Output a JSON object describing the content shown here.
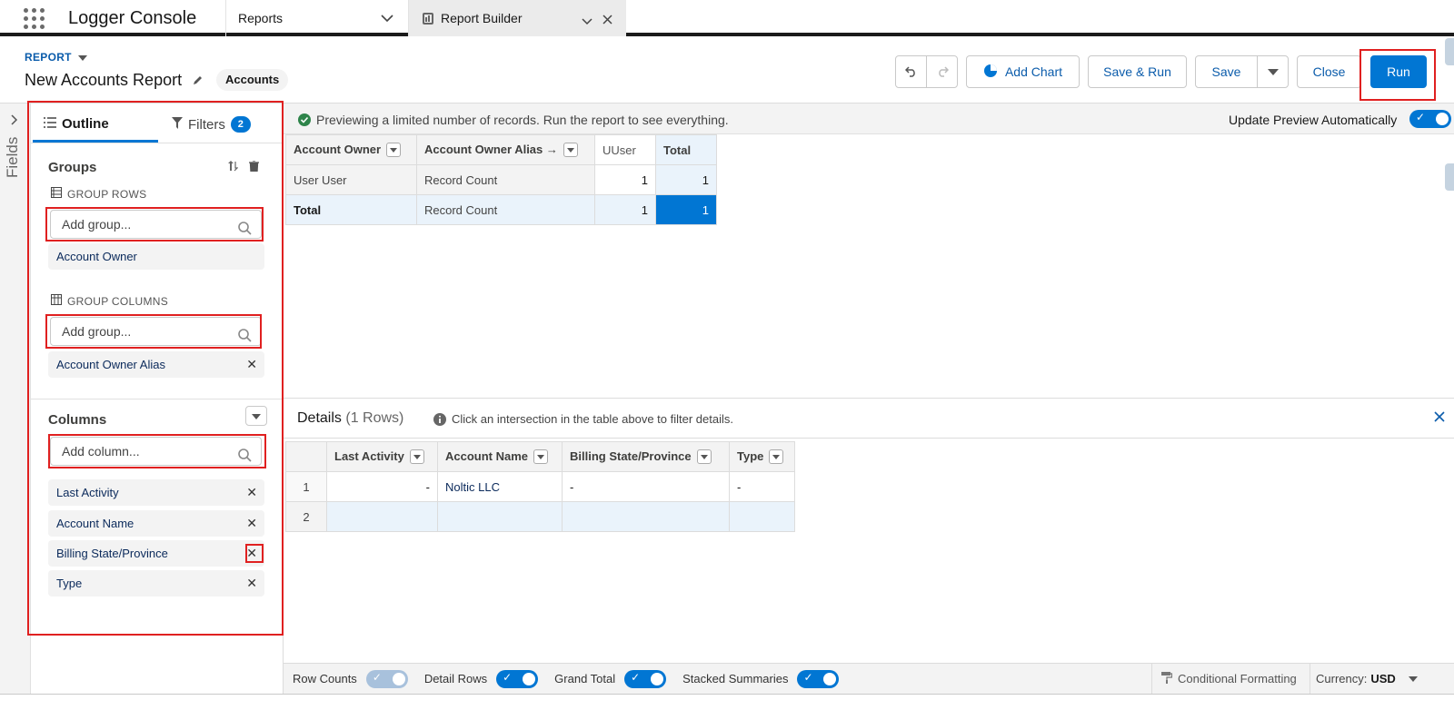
{
  "app": {
    "name": "Logger Console"
  },
  "tabs": [
    {
      "label": "Reports"
    },
    {
      "label": "Report Builder"
    }
  ],
  "header": {
    "kind": "REPORT",
    "title": "New Accounts Report",
    "object_badge": "Accounts",
    "buttons": {
      "add_chart": "Add Chart",
      "save_run": "Save & Run",
      "save": "Save",
      "close": "Close",
      "run": "Run"
    }
  },
  "left": {
    "fields_label": "Fields",
    "tab_outline": "Outline",
    "tab_filters": "Filters",
    "filters_count": "2",
    "groups_title": "Groups",
    "group_rows_label": "GROUP ROWS",
    "group_rows_placeholder": "Add group...",
    "group_rows_items": [
      "Account Owner"
    ],
    "group_columns_label": "GROUP COLUMNS",
    "group_columns_placeholder": "Add group...",
    "group_columns_items": [
      "Account Owner Alias"
    ],
    "columns_title": "Columns",
    "columns_placeholder": "Add column...",
    "columns_items": [
      "Last Activity",
      "Account Name",
      "Billing State/Province",
      "Type"
    ]
  },
  "preview": {
    "message": "Previewing a limited number of records. Run the report to see everything.",
    "auto_update_label": "Update Preview Automatically",
    "matrix": {
      "headers": [
        "Account Owner",
        "Account Owner Alias →",
        "UUser",
        "Total"
      ],
      "rows": [
        [
          "User User",
          "Record Count",
          "1",
          "1"
        ],
        [
          "Total",
          "Record Count",
          "1",
          "1"
        ]
      ]
    }
  },
  "details": {
    "title": "Details",
    "row_count": "(1 Rows)",
    "hint": "Click an intersection in the table above to filter details.",
    "headers": [
      "Last Activity",
      "Account Name",
      "Billing State/Province",
      "Type"
    ],
    "rows": [
      {
        "num": "1",
        "cells": [
          "-",
          "Noltic LLC",
          "-",
          "-"
        ]
      },
      {
        "num": "2",
        "cells": [
          "",
          "",
          "",
          ""
        ]
      }
    ]
  },
  "footer": {
    "row_counts": "Row Counts",
    "detail_rows": "Detail Rows",
    "grand_total": "Grand Total",
    "stacked_summaries": "Stacked Summaries",
    "conditional_formatting": "Conditional Formatting",
    "currency_label": "Currency:",
    "currency_value": "USD"
  },
  "colors": {
    "brand": "#0176d3",
    "highlight": "#e02020"
  }
}
